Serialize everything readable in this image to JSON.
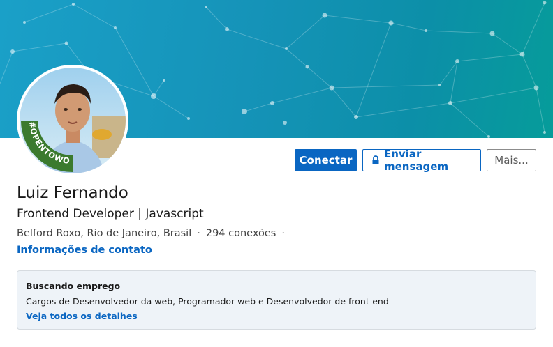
{
  "profile": {
    "name": "Luiz Fernando",
    "headline": "Frontend Developer | Javascript",
    "location": "Belford Roxo, Rio de Janeiro, Brasil",
    "separator": "·",
    "connections": "294 conexões",
    "contact_link": "Informações de contato",
    "badge_text": "#OPENTOWORK"
  },
  "actions": {
    "connect_label": "Conectar",
    "message_label": "Enviar mensagem",
    "more_label": "Mais..."
  },
  "open_to_work": {
    "title": "Buscando emprego",
    "description": "Cargos de Desenvolvedor da web, Programador web e Desenvolvedor de front-end",
    "details_link": "Veja todos os detalhes"
  },
  "colors": {
    "primary": "#0a66c2",
    "banner": "#1593b8",
    "badge_green": "#3b7a2e"
  },
  "icons": {
    "message_button_icon": "lock-icon"
  }
}
